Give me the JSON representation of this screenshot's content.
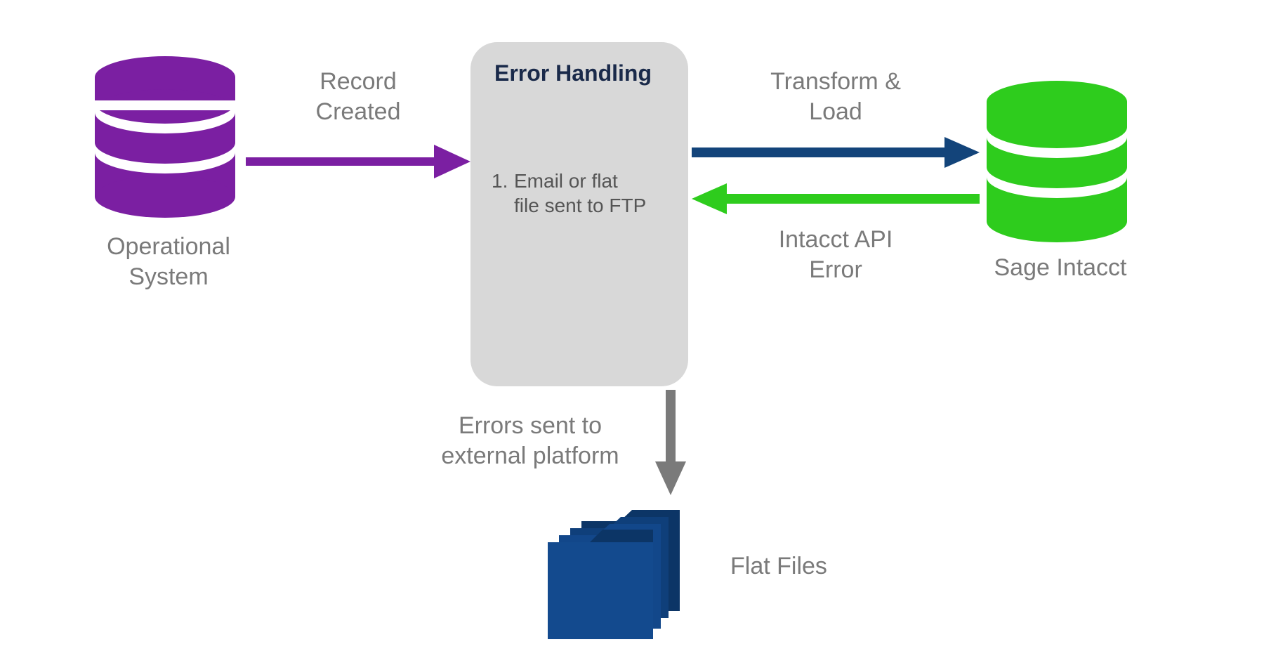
{
  "nodes": {
    "operational_system": {
      "label": "Operational\nSystem"
    },
    "error_handling": {
      "title": "Error Handling",
      "items": [
        {
          "num": "1.",
          "text": "Email or flat\nfile sent to FTP"
        }
      ]
    },
    "sage_intacct": {
      "label": "Sage Intacct"
    },
    "flat_files": {
      "label": "Flat Files"
    }
  },
  "edges": {
    "record_created": {
      "label": "Record\nCreated"
    },
    "transform_load": {
      "label": "Transform &\nLoad"
    },
    "intacct_api_error": {
      "label": "Intacct API\nError"
    },
    "errors_sent": {
      "label": "Errors sent to\nexternal platform"
    }
  },
  "colors": {
    "purple": "#7b1fa2",
    "blue_dark": "#13447a",
    "green": "#2ecc1d",
    "gray_arrow": "#7a7a7a",
    "gray_box": "#d8d8d8",
    "folder_blue": "#134a8e",
    "folder_blue_dark": "#0c3566"
  }
}
